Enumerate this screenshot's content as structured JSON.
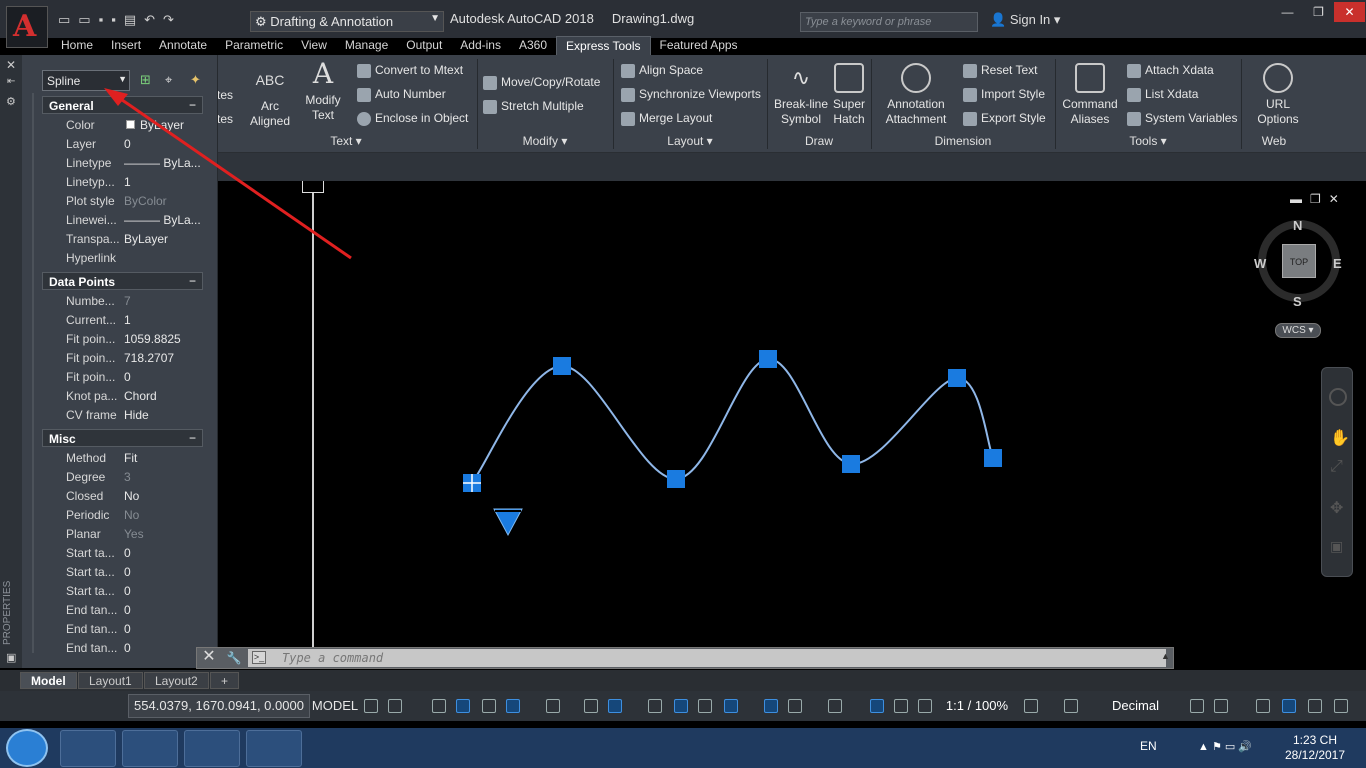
{
  "app": {
    "title": "Autodesk AutoCAD 2018",
    "drawing": "Drawing1.dwg",
    "app_letter": "A",
    "workspace": "Drafting & Annotation",
    "search_placeholder": "Type a keyword or phrase",
    "sign_in": "Sign In"
  },
  "tabs": [
    "Home",
    "Insert",
    "Annotate",
    "Parametric",
    "View",
    "Manage",
    "Output",
    "Add-ins",
    "A360",
    "Express Tools",
    "Featured Apps"
  ],
  "active_tab": "Express Tools",
  "ribbon": {
    "text": {
      "title": "Text",
      "partial_1": "tes",
      "partial_2": "tes",
      "arc_aligned": "Arc\nAligned",
      "modify_text": "Modify\nText",
      "convert_to_mtext": "Convert to Mtext",
      "auto_number": "Auto Number",
      "enclose_in_object": "Enclose in Object"
    },
    "modify": {
      "title": "Modify",
      "move_copy_rotate": "Move/Copy/Rotate",
      "stretch_multiple": "Stretch Multiple"
    },
    "layout": {
      "title": "Layout",
      "align_space": "Align Space",
      "synchronize_viewports": "Synchronize Viewports",
      "merge_layout": "Merge Layout"
    },
    "draw": {
      "title": "Draw",
      "break_line_symbol": "Break-line\nSymbol",
      "super_hatch": "Super\nHatch"
    },
    "dimension": {
      "title": "Dimension",
      "annotation_attachment": "Annotation\nAttachment",
      "reset_text": "Reset Text",
      "import_style": "Import Style",
      "export_style": "Export Style"
    },
    "tools": {
      "title": "Tools",
      "command_aliases": "Command\nAliases",
      "attach_xdata": "Attach Xdata",
      "list_xdata": "List Xdata",
      "system_variables": "System Variables"
    },
    "web": {
      "title": "Web",
      "url_options": "URL\nOptions"
    }
  },
  "properties": {
    "selected_object": "Spline",
    "sections": [
      {
        "name": "General",
        "rows": [
          {
            "k": "Color",
            "v": "ByLayer",
            "dim": false
          },
          {
            "k": "Layer",
            "v": "0",
            "dim": false
          },
          {
            "k": "Linetype",
            "v": "——— ByLa...",
            "dim": false
          },
          {
            "k": "Linetyp...",
            "v": "1",
            "dim": false
          },
          {
            "k": "Plot style",
            "v": "ByColor",
            "dim": true
          },
          {
            "k": "Linewei...",
            "v": "——— ByLa...",
            "dim": false
          },
          {
            "k": "Transpa...",
            "v": "ByLayer",
            "dim": false
          },
          {
            "k": "Hyperlink",
            "v": "",
            "dim": false
          }
        ]
      },
      {
        "name": "Data Points",
        "rows": [
          {
            "k": "Numbe...",
            "v": "7",
            "dim": true
          },
          {
            "k": "Current...",
            "v": "1",
            "dim": false
          },
          {
            "k": "Fit poin...",
            "v": "1059.8825",
            "dim": false
          },
          {
            "k": "Fit poin...",
            "v": "718.2707",
            "dim": false
          },
          {
            "k": "Fit poin...",
            "v": "0",
            "dim": false
          },
          {
            "k": "Knot pa...",
            "v": "Chord",
            "dim": false
          },
          {
            "k": "CV frame",
            "v": "Hide",
            "dim": false
          }
        ]
      },
      {
        "name": "Misc",
        "rows": [
          {
            "k": "Method",
            "v": "Fit",
            "dim": false
          },
          {
            "k": "Degree",
            "v": "3",
            "dim": true
          },
          {
            "k": "Closed",
            "v": "No",
            "dim": false
          },
          {
            "k": "Periodic",
            "v": "No",
            "dim": true
          },
          {
            "k": "Planar",
            "v": "Yes",
            "dim": true
          },
          {
            "k": "Start ta...",
            "v": "0",
            "dim": false
          },
          {
            "k": "Start ta...",
            "v": "0",
            "dim": false
          },
          {
            "k": "Start ta...",
            "v": "0",
            "dim": false
          },
          {
            "k": "End tan...",
            "v": "0",
            "dim": false
          },
          {
            "k": "End tan...",
            "v": "0",
            "dim": false
          },
          {
            "k": "End tan...",
            "v": "0",
            "dim": false
          }
        ]
      }
    ],
    "palette_label": "PROPERTIES"
  },
  "viewcube": {
    "face": "TOP",
    "n": "N",
    "s": "S",
    "e": "E",
    "w": "W",
    "wcs": "WCS"
  },
  "command": {
    "placeholder": "Type a command"
  },
  "layout_tabs": [
    "Model",
    "Layout1",
    "Layout2"
  ],
  "active_layout": "Model",
  "status": {
    "coords": "554.0379, 1670.0941, 0.0000",
    "model": "MODEL",
    "scale": "1:1 / 100%",
    "units": "Decimal"
  },
  "taskbar": {
    "lang": "EN",
    "time": "1:23 CH",
    "date": "28/12/2017"
  },
  "colors": {
    "grip": "#1a7be0",
    "spline": "#8fb7e8",
    "annotation_arrow": "#e02020",
    "accent": "#c62828"
  }
}
